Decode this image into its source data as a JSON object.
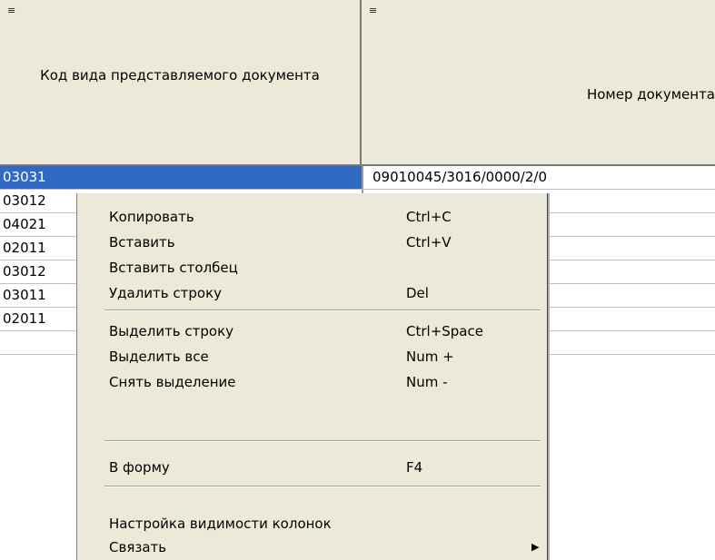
{
  "header": {
    "col1_icon": "≡",
    "col1_label": "Код вида представляемого документа",
    "col2_icon": "≡",
    "col2_label": "Номер документа"
  },
  "rows": [
    {
      "code": "03031",
      "number": "09010045/3016/0000/2/0"
    },
    {
      "code": "03012",
      "number": ""
    },
    {
      "code": "04021",
      "number": ""
    },
    {
      "code": "02011",
      "number": ""
    },
    {
      "code": "03012",
      "number": ""
    },
    {
      "code": "03011",
      "number": ""
    },
    {
      "code": "02011",
      "number": ""
    },
    {
      "code": "",
      "number": ""
    }
  ],
  "menu": {
    "copy": {
      "label": "Копировать",
      "shortcut": "Ctrl+C"
    },
    "paste": {
      "label": "Вставить",
      "shortcut": "Ctrl+V"
    },
    "paste_column": {
      "label": "Вставить столбец"
    },
    "delete_row": {
      "label": "Удалить строку",
      "shortcut": "Del"
    },
    "select_row": {
      "label": "Выделить строку",
      "shortcut": "Ctrl+Space"
    },
    "select_all": {
      "label": "Выделить все",
      "shortcut": "Num +"
    },
    "deselect": {
      "label": "Снять выделение",
      "shortcut": "Num -"
    },
    "to_form": {
      "label": "В форму",
      "shortcut": "F4"
    },
    "column_visibility": {
      "label": "Настройка видимости колонок"
    },
    "link": {
      "label": "Связать",
      "arrow_icon": "submenu-arrow"
    }
  },
  "colors": {
    "selection": "#316ac5",
    "header_bg": "#ece9d8",
    "menu_bg": "#ece9d8"
  }
}
